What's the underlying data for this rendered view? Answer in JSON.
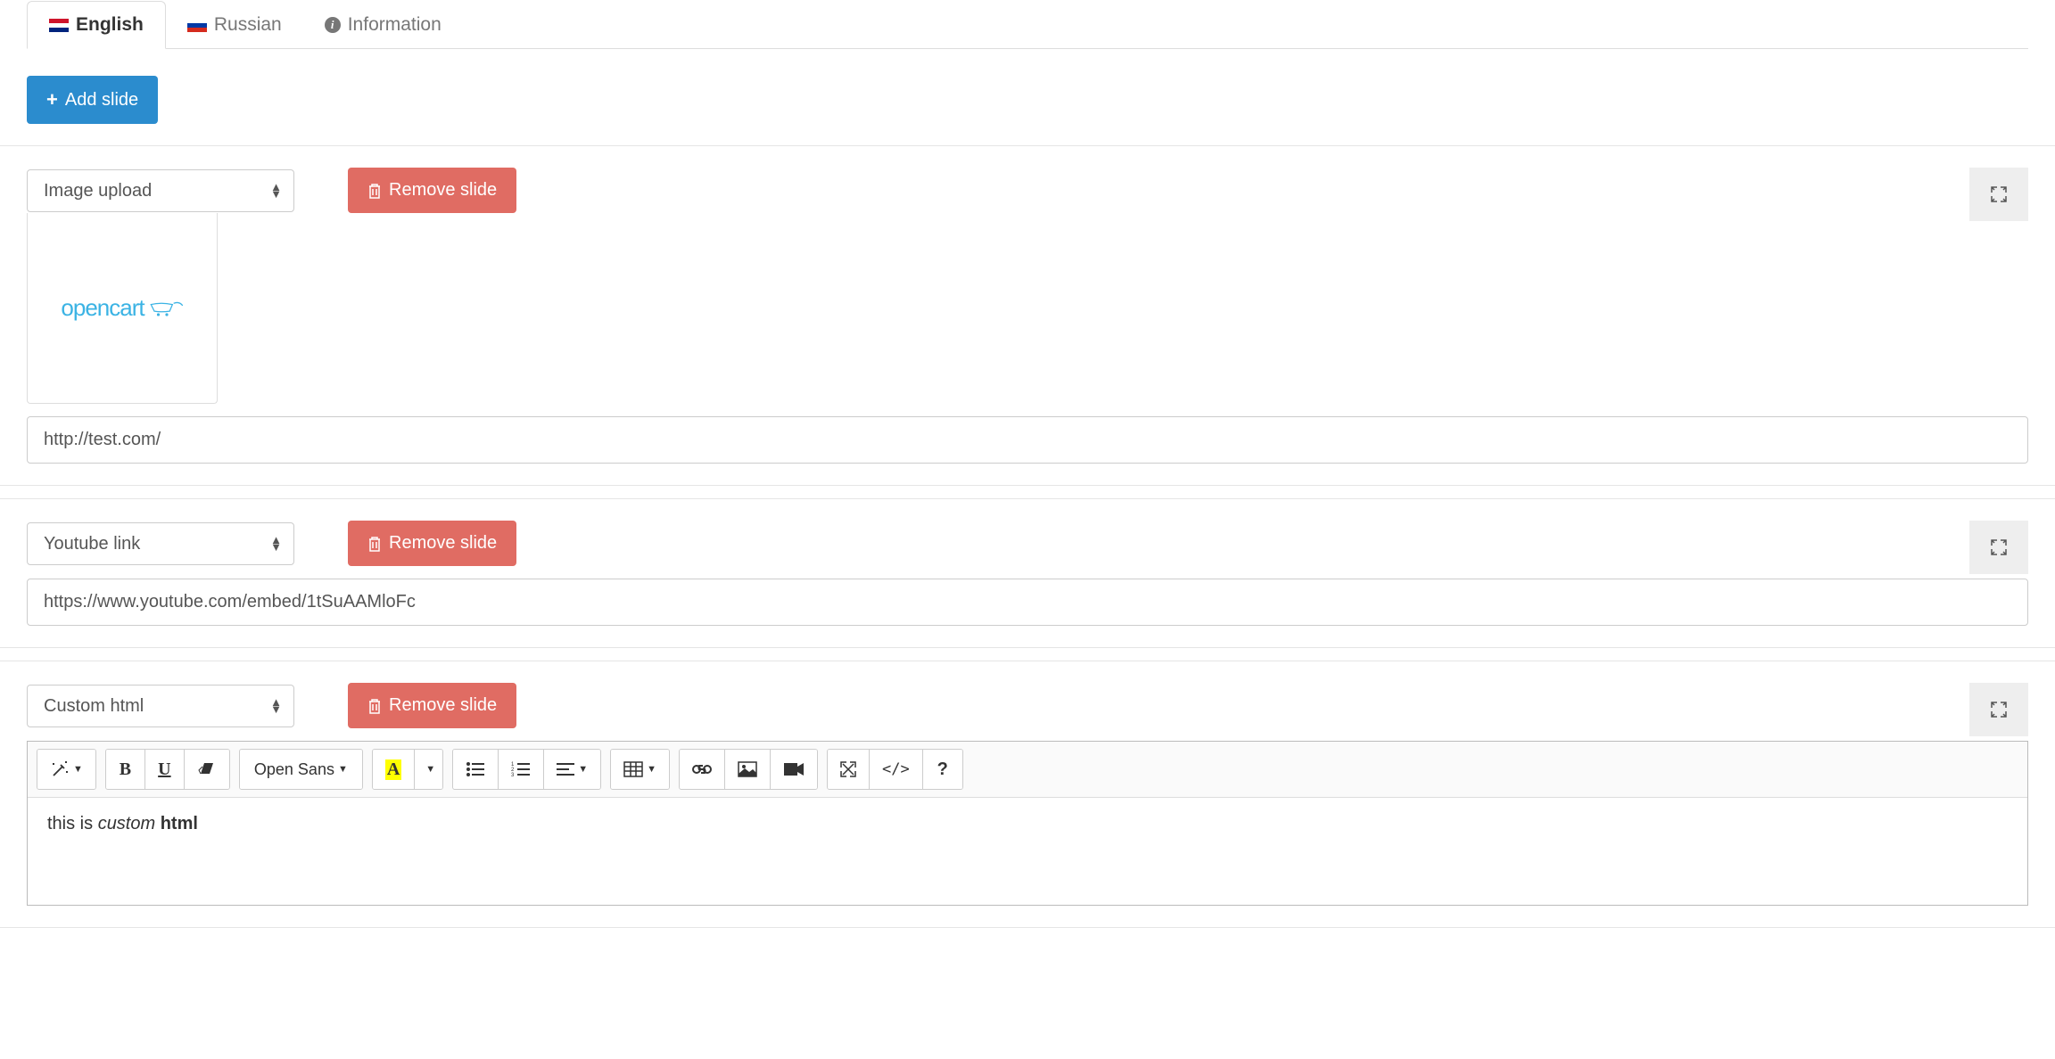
{
  "tabs": {
    "english": "English",
    "russian": "Russian",
    "information": "Information"
  },
  "buttons": {
    "add_slide": "Add slide",
    "remove_slide": "Remove slide"
  },
  "slide1": {
    "type_value": "Image upload",
    "url_value": "http://test.com/",
    "logo_text": "opencart"
  },
  "slide2": {
    "type_value": "Youtube link",
    "url_value": "https://www.youtube.com/embed/1tSuAAMloFc"
  },
  "slide3": {
    "type_value": "Custom html",
    "editor_font": "Open Sans",
    "content_plain": "this is ",
    "content_italic": "custom",
    "content_space": " ",
    "content_bold": "html"
  },
  "toolbar": {
    "bold": "B",
    "underline": "U",
    "color": "A",
    "help": "?",
    "code": "</>"
  }
}
